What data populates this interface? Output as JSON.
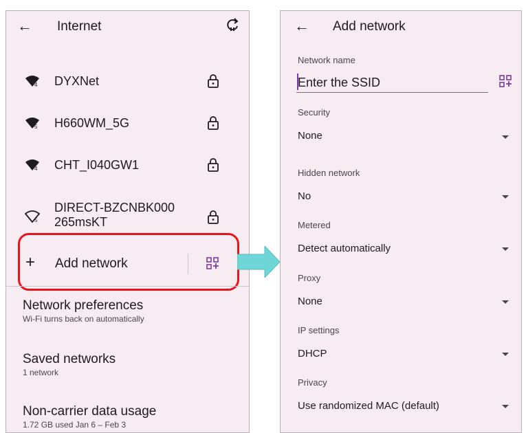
{
  "left_screen": {
    "title": "Internet",
    "networks": [
      {
        "ssid": "DYXNet",
        "signal_badge": "4",
        "secured": true
      },
      {
        "ssid": "H660WM_5G",
        "signal_badge": "5",
        "secured": true
      },
      {
        "ssid": "CHT_I040GW1",
        "signal_badge": "4",
        "secured": true
      },
      {
        "ssid": "DIRECT-BZCNBK000 265msKT",
        "ssid_line1": "DIRECT-BZCNBK000",
        "ssid_line2": "265msKT",
        "signal_badge": "5",
        "secured": true
      }
    ],
    "add_network_label": "Add network",
    "add_network_plus": "+",
    "preferences": [
      {
        "title": "Network preferences",
        "subtitle": "Wi-Fi turns back on automatically"
      },
      {
        "title": "Saved networks",
        "subtitle": "1 network"
      },
      {
        "title": "Non-carrier data usage",
        "subtitle": "1.72 GB used Jan 6 – Feb 3"
      }
    ]
  },
  "right_screen": {
    "title": "Add network",
    "network_name": {
      "label": "Network name",
      "placeholder": "Enter the SSID",
      "value": ""
    },
    "fields": [
      {
        "label": "Security",
        "value": "None"
      },
      {
        "label": "Hidden network",
        "value": "No"
      },
      {
        "label": "Metered",
        "value": "Detect automatically"
      },
      {
        "label": "Proxy",
        "value": "None"
      },
      {
        "label": "IP settings",
        "value": "DHCP"
      },
      {
        "label": "Privacy",
        "value": "Use randomized MAC (default)"
      }
    ]
  },
  "icons": {
    "back": "back-arrow-icon",
    "refresh": "refresh-icon",
    "wifi": "wifi-signal-icon",
    "lock": "lock-icon",
    "qr": "qr-code-scan-icon",
    "dropdown": "dropdown-caret-icon",
    "callout_arrow": "callout-arrow"
  },
  "colors": {
    "screen_bg": "#f7ecf1",
    "highlight_border": "#e8141c",
    "callout_arrow": "#6fd6d8",
    "text": "#1d1b20"
  }
}
